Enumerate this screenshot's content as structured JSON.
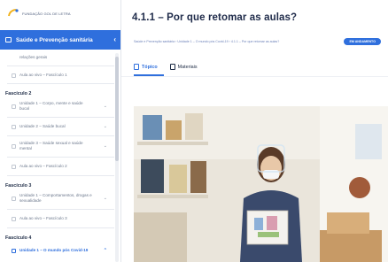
{
  "logo": {
    "text": "FUNDAÇÃO GOL DE LETRA",
    "accent": "#f2b21c"
  },
  "sidebar": {
    "module_title": "Saúde e Prevenção sanitária",
    "items": [
      {
        "kind": "item",
        "label": "relações gerais",
        "chevron": false
      },
      {
        "kind": "item",
        "label": "Aula ao vivo – Fascículo 1",
        "chevron": false
      },
      {
        "kind": "fasc",
        "label": "Fascículo 2"
      },
      {
        "kind": "item",
        "label": "Unidade 1 – Corpo, mente e saúde bucal",
        "chevron": true
      },
      {
        "kind": "item",
        "label": "Unidade 2 – Saúde bucal",
        "chevron": true
      },
      {
        "kind": "item",
        "label": "Unidade 3 – Saúde sexual e saúde mental",
        "chevron": true
      },
      {
        "kind": "item",
        "label": "Aula ao vivo – Fascículo 2",
        "chevron": false
      },
      {
        "kind": "fasc",
        "label": "Fascículo 3"
      },
      {
        "kind": "item",
        "label": "Unidade 1 – Comportamentos, drogas e sexualidade",
        "chevron": true
      },
      {
        "kind": "item",
        "label": "Aula ao vivo – Fascículo 3",
        "chevron": false
      },
      {
        "kind": "fasc",
        "label": "Fascículo 4"
      },
      {
        "kind": "item",
        "label": "Unidade 1 – O mundo pós Covid-19",
        "chevron": true,
        "active": true
      }
    ]
  },
  "main": {
    "title": "4.1.1 – Por que retomar as aulas?",
    "breadcrumb": "Saúde e Prevenção sanitária  ›  Unidade 1 – O mundo pós Covid-19  ›  4.1.1 – Por que retomar as aulas?",
    "status_badge": "EM ANDAMENTO",
    "tabs": [
      {
        "label": "Tópico",
        "icon": "document-icon",
        "active": true
      },
      {
        "label": "Materiais",
        "icon": "file-icon",
        "active": false
      }
    ]
  },
  "colors": {
    "accent": "#2f6fdd",
    "title": "#1f2b4a",
    "muted": "#6b778c"
  }
}
